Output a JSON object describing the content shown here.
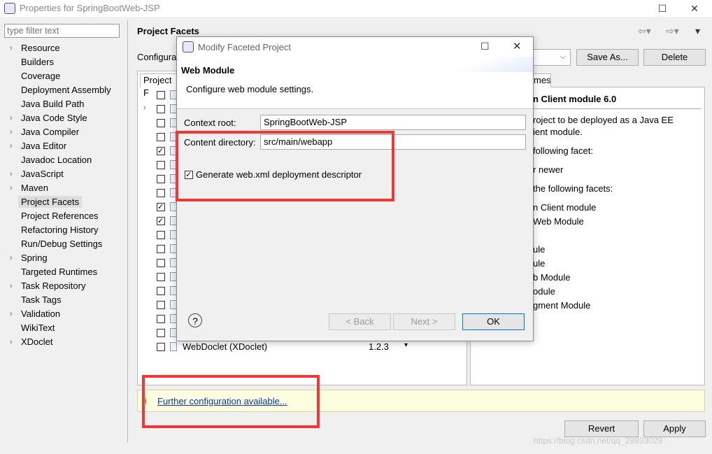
{
  "window": {
    "title": "Properties for SpringBootWeb-JSP"
  },
  "filter": {
    "placeholder": "type filter text"
  },
  "nav": {
    "items": [
      {
        "label": "Resource",
        "expandable": true
      },
      {
        "label": "Builders",
        "expandable": false
      },
      {
        "label": "Coverage",
        "expandable": false
      },
      {
        "label": "Deployment Assembly",
        "expandable": false
      },
      {
        "label": "Java Build Path",
        "expandable": false
      },
      {
        "label": "Java Code Style",
        "expandable": true
      },
      {
        "label": "Java Compiler",
        "expandable": true
      },
      {
        "label": "Java Editor",
        "expandable": true
      },
      {
        "label": "Javadoc Location",
        "expandable": false
      },
      {
        "label": "JavaScript",
        "expandable": true
      },
      {
        "label": "Maven",
        "expandable": true
      },
      {
        "label": "Project Facets",
        "expandable": false,
        "selected": true
      },
      {
        "label": "Project References",
        "expandable": false
      },
      {
        "label": "Refactoring History",
        "expandable": false
      },
      {
        "label": "Run/Debug Settings",
        "expandable": false
      },
      {
        "label": "Spring",
        "expandable": true
      },
      {
        "label": "Targeted Runtimes",
        "expandable": false
      },
      {
        "label": "Task Repository",
        "expandable": true
      },
      {
        "label": "Task Tags",
        "expandable": false
      },
      {
        "label": "Validation",
        "expandable": true
      },
      {
        "label": "WikiText",
        "expandable": false
      },
      {
        "label": "XDoclet",
        "expandable": true
      }
    ]
  },
  "page": {
    "title": "Project Facets",
    "config_label": "Configura",
    "save_as": "Save As...",
    "delete": "Delete",
    "tab_project": "Project F",
    "tab_runtimes": "mes",
    "facet_row": {
      "name": "WebDoclet (XDoclet)",
      "version": "1.2.3"
    },
    "details_title": "n Client module 6.0",
    "details_lines": [
      "roject to be deployed as a Java EE",
      "ient module.",
      "following facet:",
      "r newer",
      "the following facets:",
      "n Client module",
      "Web Module",
      "ule",
      "ule",
      "b Module",
      "odule",
      "gment Module"
    ],
    "further_config": "Further configuration available...",
    "revert": "Revert",
    "apply": "Apply",
    "watermark": "https://blog.csdn.net/qq_29833029"
  },
  "dialog": {
    "title": "Modify Faceted Project",
    "header_title": "Web Module",
    "header_desc": "Configure web module settings.",
    "context_root_label": "Context root:",
    "context_root_value": "SpringBootWeb-JSP",
    "content_dir_label": "Content directory:",
    "content_dir_value": "src/main/webapp",
    "generate_label": "Generate web.xml deployment descriptor",
    "generate_checked": true,
    "back": "< Back",
    "next": "Next >",
    "ok": "OK",
    "help_glyph": "?"
  },
  "colors": {
    "highlight": "#f03838",
    "link": "#0a3a9f"
  }
}
